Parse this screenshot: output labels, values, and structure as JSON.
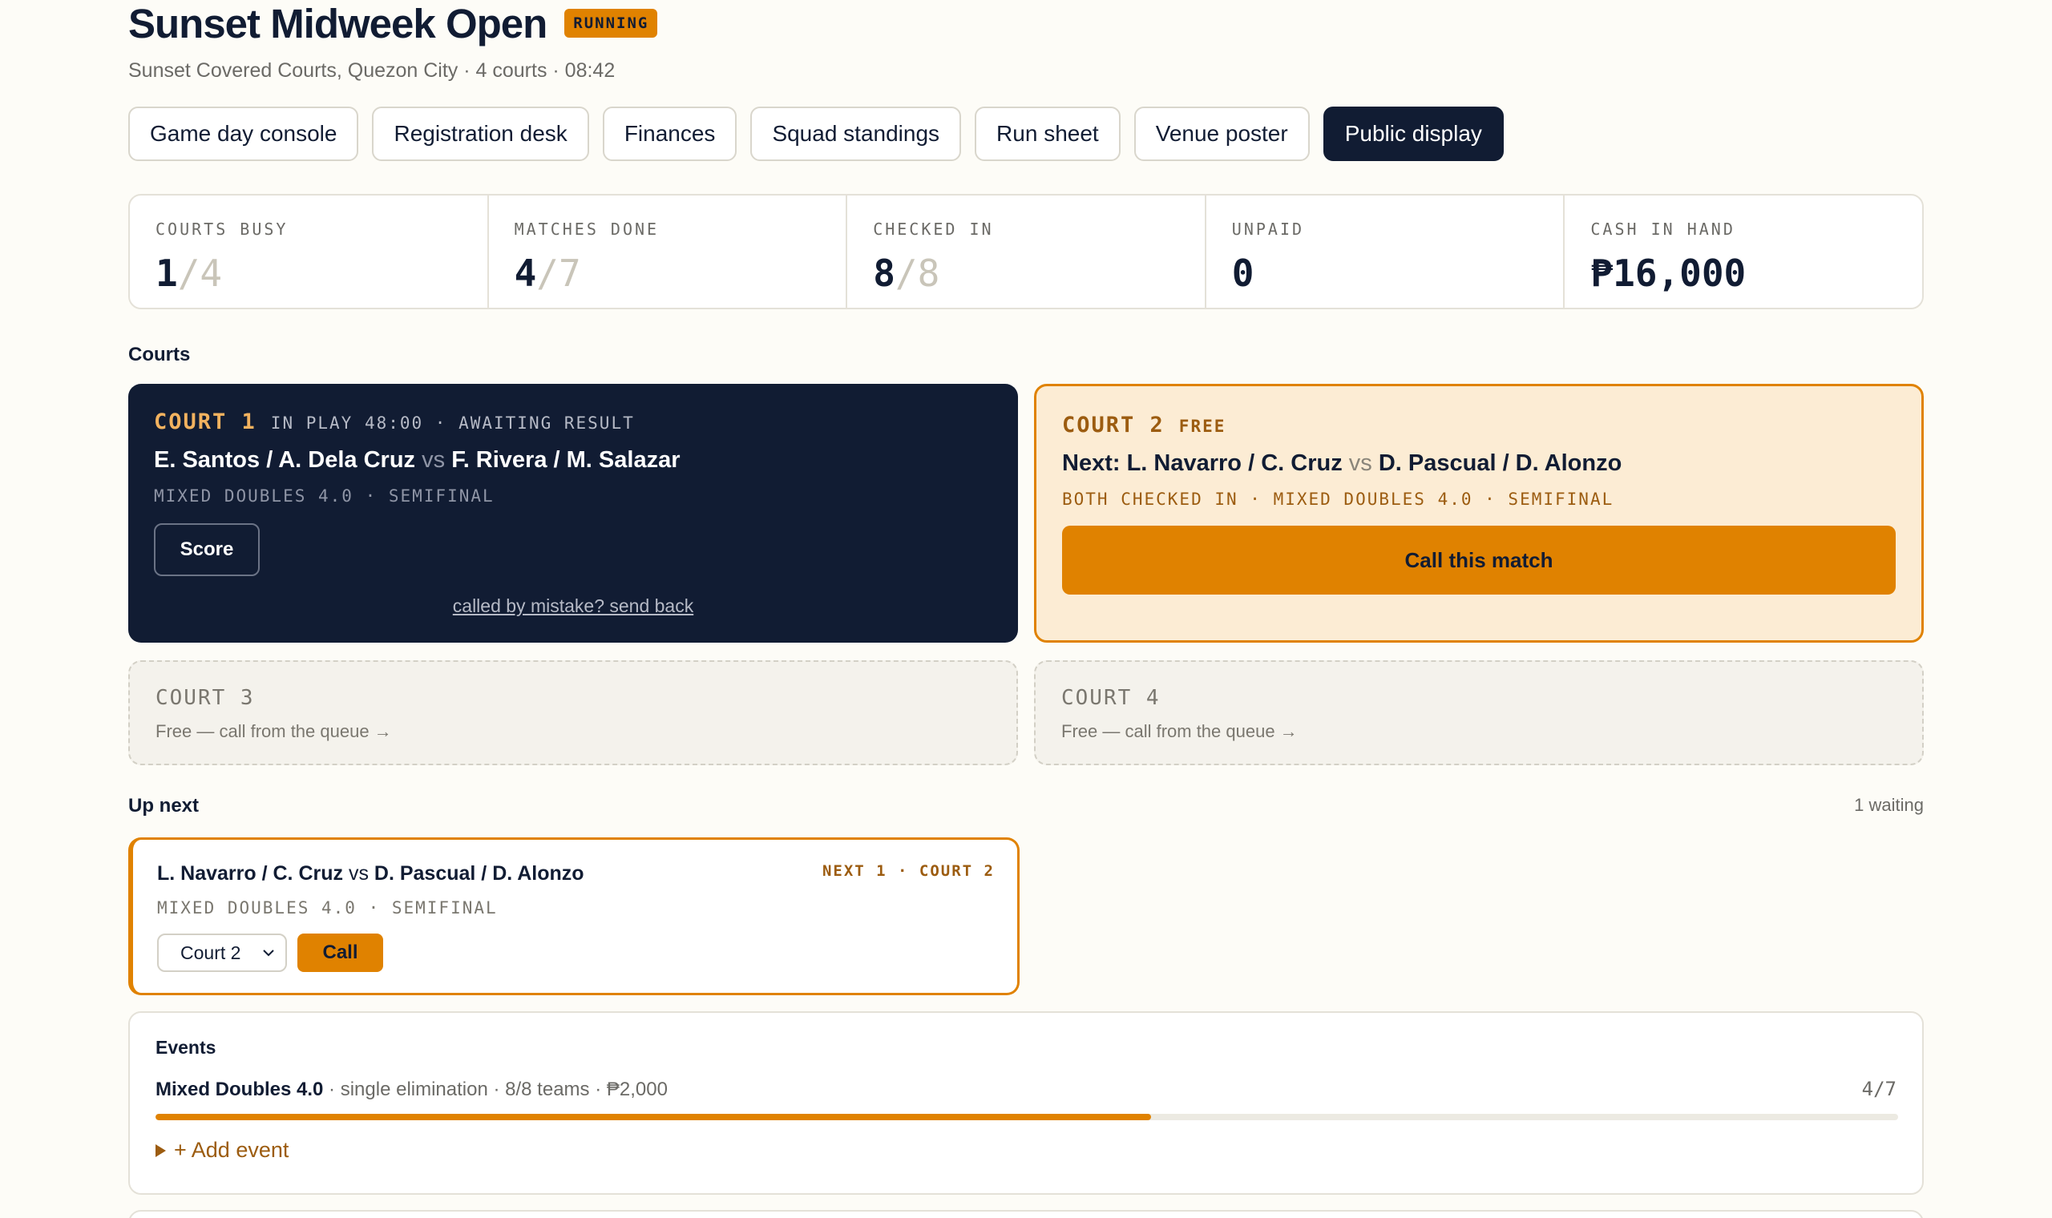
{
  "header": {
    "title": "Sunset Midweek Open",
    "status_badge": "RUNNING",
    "subtitle": "Sunset Covered Courts, Quezon City · 4 courts · 08:42"
  },
  "tabs": [
    {
      "label": "Game day console",
      "active": false
    },
    {
      "label": "Registration desk",
      "active": false
    },
    {
      "label": "Finances",
      "active": false
    },
    {
      "label": "Squad standings",
      "active": false
    },
    {
      "label": "Run sheet",
      "active": false
    },
    {
      "label": "Venue poster",
      "active": false
    },
    {
      "label": "Public display",
      "active": true
    }
  ],
  "stats": [
    {
      "label": "COURTS BUSY",
      "value": "1",
      "total": "/4"
    },
    {
      "label": "MATCHES DONE",
      "value": "4",
      "total": "/7"
    },
    {
      "label": "CHECKED IN",
      "value": "8",
      "total": "/8"
    },
    {
      "label": "UNPAID",
      "value": "0",
      "total": ""
    },
    {
      "label": "CASH IN HAND",
      "value": "₱16,000",
      "total": ""
    }
  ],
  "courts_section": {
    "label": "Courts"
  },
  "court1": {
    "name": "COURT 1",
    "status": "IN PLAY 48:00 · AWAITING RESULT",
    "team_a": "E. Santos / A. Dela Cruz",
    "vs": "vs",
    "team_b": "F. Rivera / M. Salazar",
    "meta": "MIXED DOUBLES 4.0 · SEMIFINAL",
    "score_label": "Score",
    "send_back": "called by mistake? send back"
  },
  "court2": {
    "name": "COURT 2",
    "status": "FREE",
    "next_prefix": "Next:",
    "team_a": "L. Navarro / C. Cruz",
    "vs": "vs",
    "team_b": "D. Pascual / D. Alonzo",
    "meta": "BOTH CHECKED IN · MIXED DOUBLES 4.0 · SEMIFINAL",
    "call_label": "Call this match"
  },
  "court3": {
    "name": "COURT 3",
    "free_text": "Free — call from the queue →"
  },
  "court4": {
    "name": "COURT 4",
    "free_text": "Free — call from the queue →"
  },
  "up_next": {
    "label": "Up next",
    "waiting": "1 waiting",
    "item": {
      "team_a": "L. Navarro / C. Cruz",
      "vs": "vs",
      "team_b": "D. Pascual / D. Alonzo",
      "tag": "NEXT 1 · COURT 2",
      "meta": "MIXED DOUBLES 4.0 · SEMIFINAL",
      "court_select": "Court 2",
      "call_label": "Call"
    }
  },
  "events": {
    "title": "Events",
    "items": [
      {
        "name": "Mixed Doubles 4.0",
        "details": " · single elimination · 8/8 teams · ₱2,000",
        "count": "4/7",
        "progress": 0.5714
      }
    ],
    "add_label": "+ Add event"
  },
  "colors": {
    "accent": "#e08200",
    "navy": "#111c33",
    "background": "#fdfcf7"
  }
}
